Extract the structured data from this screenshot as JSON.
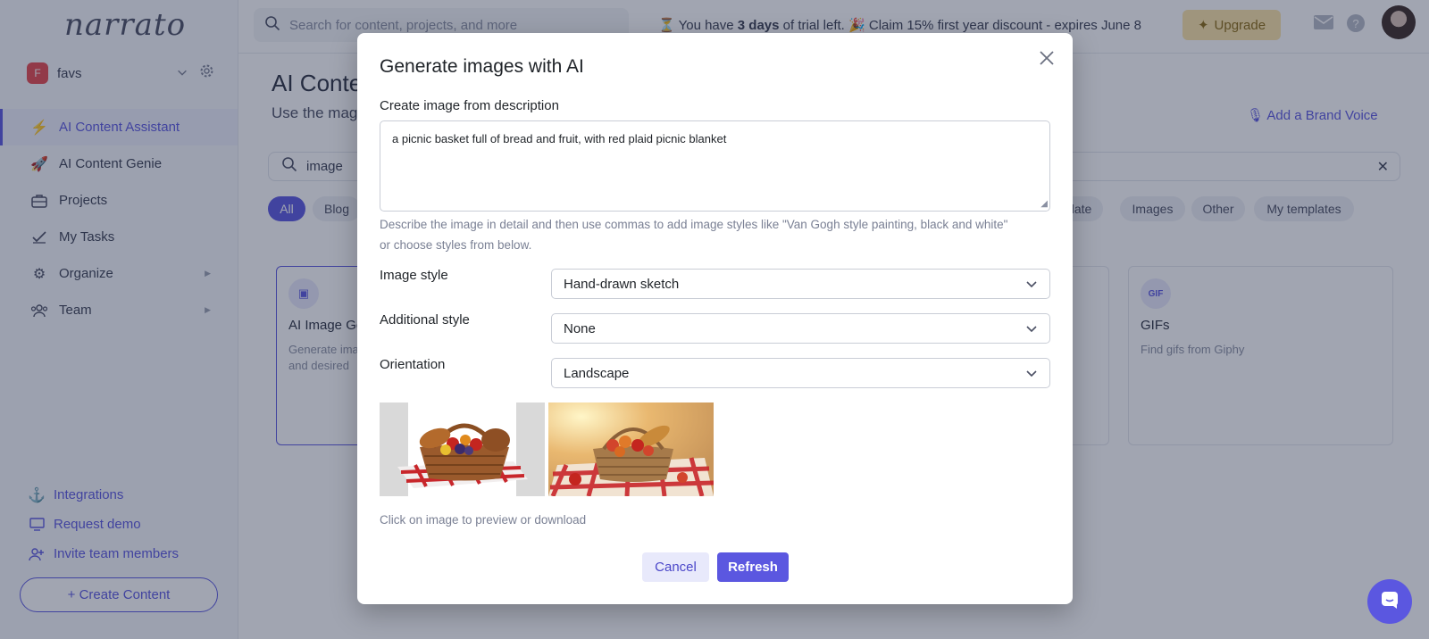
{
  "sidebar": {
    "logo": "narrato",
    "workspace": {
      "initial": "F",
      "name": "favs"
    },
    "items": [
      {
        "label": "AI Content Assistant"
      },
      {
        "label": "AI Content Genie"
      },
      {
        "label": "Projects"
      },
      {
        "label": "My Tasks"
      },
      {
        "label": "Organize"
      },
      {
        "label": "Team"
      }
    ],
    "bottom_links": [
      {
        "label": "Integrations"
      },
      {
        "label": "Request demo"
      },
      {
        "label": "Invite team members"
      }
    ],
    "create_button": "+ Create Content"
  },
  "topbar": {
    "search_placeholder": "Search for content, projects, and more",
    "trial_prefix": "You have ",
    "trial_days": "3 days",
    "trial_suffix": " of trial left.",
    "discount": "Claim 15% first year discount - expires June 8",
    "upgrade_label": "Upgrade"
  },
  "main": {
    "title": "AI Conten",
    "subtitle": "Use the mag",
    "brand_voice": "Add a Brand Voice",
    "search_value": "image",
    "chips": [
      "All",
      "Blog",
      "slate",
      "Images",
      "Other",
      "My templates"
    ],
    "cards": [
      {
        "title": "AI Image Ge",
        "desc_line1": "Generate ima",
        "desc_line2": "and desired"
      },
      {
        "title": "GIFs",
        "desc_line1": "Find gifs from Giphy",
        "desc_line2": ""
      }
    ]
  },
  "modal": {
    "title": "Generate images with AI",
    "description_label": "Create image from description",
    "description_value": "a picnic basket full of bread and fruit, with red plaid picnic blanket",
    "help_line1": "Describe the image in detail and then use commas to add image styles like \"Van Gogh style painting, black and white\"",
    "help_line2": "or choose styles from below.",
    "fields": [
      {
        "label": "Image style",
        "value": "Hand-drawn sketch"
      },
      {
        "label": "Additional style",
        "value": "None"
      },
      {
        "label": "Orientation",
        "value": "Landscape"
      }
    ],
    "preview_note": "Click on image to preview or download",
    "cancel_label": "Cancel",
    "refresh_label": "Refresh"
  },
  "colors": {
    "accent": "#5b57e0",
    "upgrade_bg": "#fbe3a6",
    "plaid_red": "#c8262b"
  },
  "icons": {
    "search": "search-icon",
    "close": "close-icon",
    "chevron": "chevron-down-icon",
    "chat": "chat-icon"
  }
}
